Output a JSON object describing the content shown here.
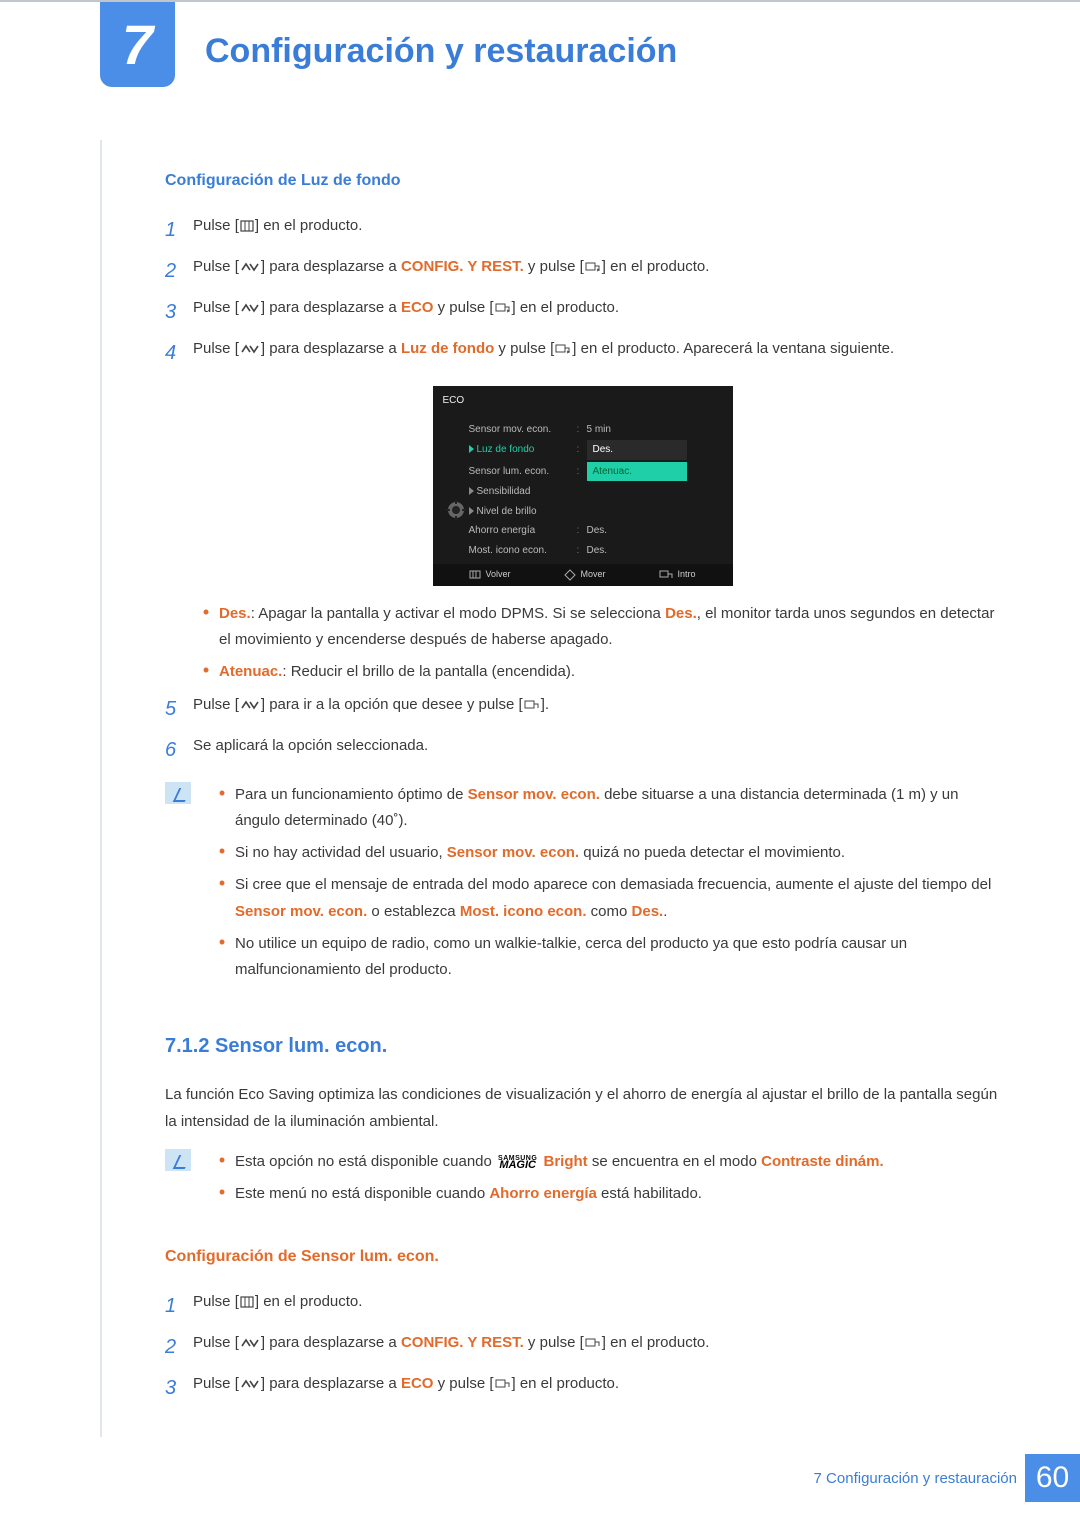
{
  "chapter": {
    "number": "7",
    "title": "Configuración y restauración"
  },
  "section1": {
    "title": "Configuración de Luz de fondo",
    "steps": {
      "s1": {
        "n": "1",
        "a": "Pulse [",
        "b": "] en el producto."
      },
      "s2": {
        "n": "2",
        "a": "Pulse [",
        "b": "] para desplazarse a ",
        "c": "CONFIG. Y REST.",
        "d": " y pulse [",
        "e": "] en el producto."
      },
      "s3": {
        "n": "3",
        "a": "Pulse [",
        "b": "] para desplazarse a ",
        "c": "ECO",
        "d": " y pulse [",
        "e": "] en el producto."
      },
      "s4": {
        "n": "4",
        "a": "Pulse [",
        "b": "] para desplazarse a ",
        "c": "Luz de fondo",
        "d": " y pulse [",
        "e": "] en el producto. Aparecerá la ventana siguiente."
      },
      "s5": {
        "n": "5",
        "a": "Pulse [",
        "b": "] para ir a la opción que desee y pulse [",
        "c": "]."
      },
      "s6": {
        "n": "6",
        "a": "Se aplicará la opción seleccionada."
      }
    },
    "bullets": {
      "b1": {
        "a": "Des.",
        "b": ": Apagar la pantalla y activar el modo DPMS. Si se selecciona ",
        "c": "Des.",
        "d": ", el monitor tarda unos segundos en detectar el movimiento y encenderse después de haberse apagado."
      },
      "b2": {
        "a": "Atenuac.",
        "b": ": Reducir el brillo de la pantalla (encendida)."
      }
    }
  },
  "osd": {
    "title": "ECO",
    "rows": {
      "r1": {
        "label": "Sensor mov. econ.",
        "val": "5 min"
      },
      "r2": {
        "label": "Luz de fondo",
        "val": "Des.",
        "val2": "Atenuac."
      },
      "r3": {
        "label": "Sensor lum. econ."
      },
      "r4": {
        "label": "Sensibilidad"
      },
      "r5": {
        "label": "Nivel de brillo"
      },
      "r6": {
        "label": "Ahorro energía",
        "val": "Des."
      },
      "r7": {
        "label": "Most. icono econ.",
        "val": "Des."
      }
    },
    "footer": {
      "back": "Volver",
      "move": "Mover",
      "enter": "Intro"
    }
  },
  "note1": {
    "i1": {
      "a": "Para un funcionamiento óptimo de ",
      "b": "Sensor mov. econ.",
      "c": " debe situarse a una distancia determinada (1 m) y un ángulo determinado (40˚)."
    },
    "i2": {
      "a": "Si no hay actividad del usuario, ",
      "b": "Sensor mov. econ.",
      "c": " quizá no pueda detectar el movimiento."
    },
    "i3": {
      "a": "Si cree que el mensaje de entrada del modo aparece con demasiada frecuencia, aumente el ajuste del tiempo del ",
      "b": "Sensor mov. econ.",
      "c": " o establezca ",
      "d": "Most. icono econ.",
      "e": " como ",
      "f": "Des.",
      "g": "."
    },
    "i4": {
      "a": "No utilice un equipo de radio, como un walkie-talkie, cerca del producto ya que esto podría causar un malfuncionamiento del producto."
    }
  },
  "section712": {
    "head": "7.1.2  Sensor lum. econ.",
    "para": "La función Eco Saving optimiza las condiciones de visualización y el ahorro de energía al ajustar el brillo de la pantalla según la intensidad de la iluminación ambiental."
  },
  "note2": {
    "i1": {
      "a": "Esta opción no está disponible cuando ",
      "b": "Bright",
      "c": " se encuentra en el modo ",
      "d": "Contraste dinám."
    },
    "i2": {
      "a": "Este menú no está disponible cuando ",
      "b": "Ahorro energía",
      "c": " está habilitado."
    }
  },
  "section2": {
    "title": "Configuración de Sensor lum. econ.",
    "steps": {
      "s1": {
        "n": "1",
        "a": "Pulse [",
        "b": "] en el producto."
      },
      "s2": {
        "n": "2",
        "a": "Pulse [",
        "b": "] para desplazarse a ",
        "c": "CONFIG. Y REST.",
        "d": " y pulse [",
        "e": "] en el producto."
      },
      "s3": {
        "n": "3",
        "a": "Pulse [",
        "b": "] para desplazarse a ",
        "c": "ECO",
        "d": " y pulse [",
        "e": "] en el producto."
      }
    }
  },
  "footer": {
    "text": "7 Configuración y restauración",
    "page": "60"
  },
  "magic": {
    "top": "SAMSUNG",
    "bot": "MAGIC"
  }
}
